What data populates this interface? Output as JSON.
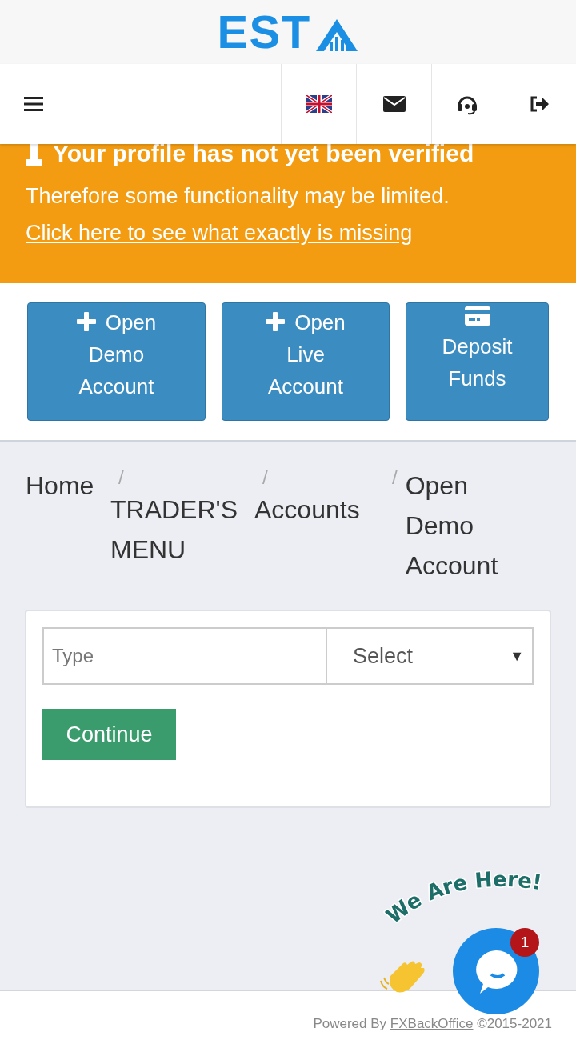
{
  "logo": {
    "text": "EST"
  },
  "nav": {
    "icons": [
      {
        "kind": "flag"
      },
      {
        "kind": "mail"
      },
      {
        "kind": "support"
      },
      {
        "kind": "logout"
      }
    ]
  },
  "alert": {
    "title": "Your profile has not yet been verified",
    "message": "Therefore some functionality may be limited.",
    "link": "Click here to see what exactly is missing"
  },
  "actions": [
    {
      "kind": "plus",
      "label": "Open Demo Account"
    },
    {
      "kind": "plus",
      "label": "Open Live Account"
    },
    {
      "kind": "card",
      "label": "Deposit Funds"
    }
  ],
  "breadcrumb": [
    {
      "label": "Home"
    },
    {
      "separator": "/",
      "label": "TRADER'S MENU"
    },
    {
      "separator": "/",
      "label": "Accounts"
    },
    {
      "separator": "/",
      "label": "Open Demo Account"
    }
  ],
  "form": {
    "field_label": "Type",
    "select": {
      "value": "Select",
      "arrow": "▼"
    },
    "submit": "Continue"
  },
  "chat": {
    "greeting": "We Are Here!",
    "badge": "1"
  },
  "footer": {
    "text": "Powered By",
    "link": "FXBackOffice",
    "copyright": "©2015-2021"
  }
}
